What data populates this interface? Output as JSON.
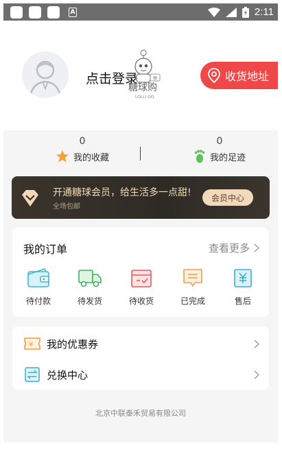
{
  "status_bar": {
    "time": "2:11",
    "notification_letter": "A"
  },
  "profile": {
    "login_text": "点击登录",
    "mascot_brand": "糖球购",
    "mascot_sub": "LOLLI GO",
    "address_button": "收货地址"
  },
  "stats": {
    "favorites_count": "0",
    "favorites_label": "我的收藏",
    "footprints_count": "0",
    "footprints_label": "我的足迹"
  },
  "vip": {
    "title": "开通糖球会员，给生活多一点甜!",
    "subtitle": "全场包邮",
    "button": "会员中心"
  },
  "orders": {
    "title": "我的订单",
    "more": "查看更多",
    "items": [
      {
        "label": "待付款",
        "icon": "wallet-icon"
      },
      {
        "label": "待发货",
        "icon": "truck-icon"
      },
      {
        "label": "待收货",
        "icon": "box-icon"
      },
      {
        "label": "已完成",
        "icon": "message-icon"
      },
      {
        "label": "售后",
        "icon": "yen-doc-icon"
      }
    ]
  },
  "extras": {
    "coupons": "我的优惠券",
    "exchange": "兑换中心"
  },
  "footer": {
    "company": "北京中联泰禾贸易有限公司"
  },
  "colors": {
    "accent_red": "#f04848",
    "vip_gold": "#f3d9bb",
    "status_bar": "#6d6d6d"
  }
}
